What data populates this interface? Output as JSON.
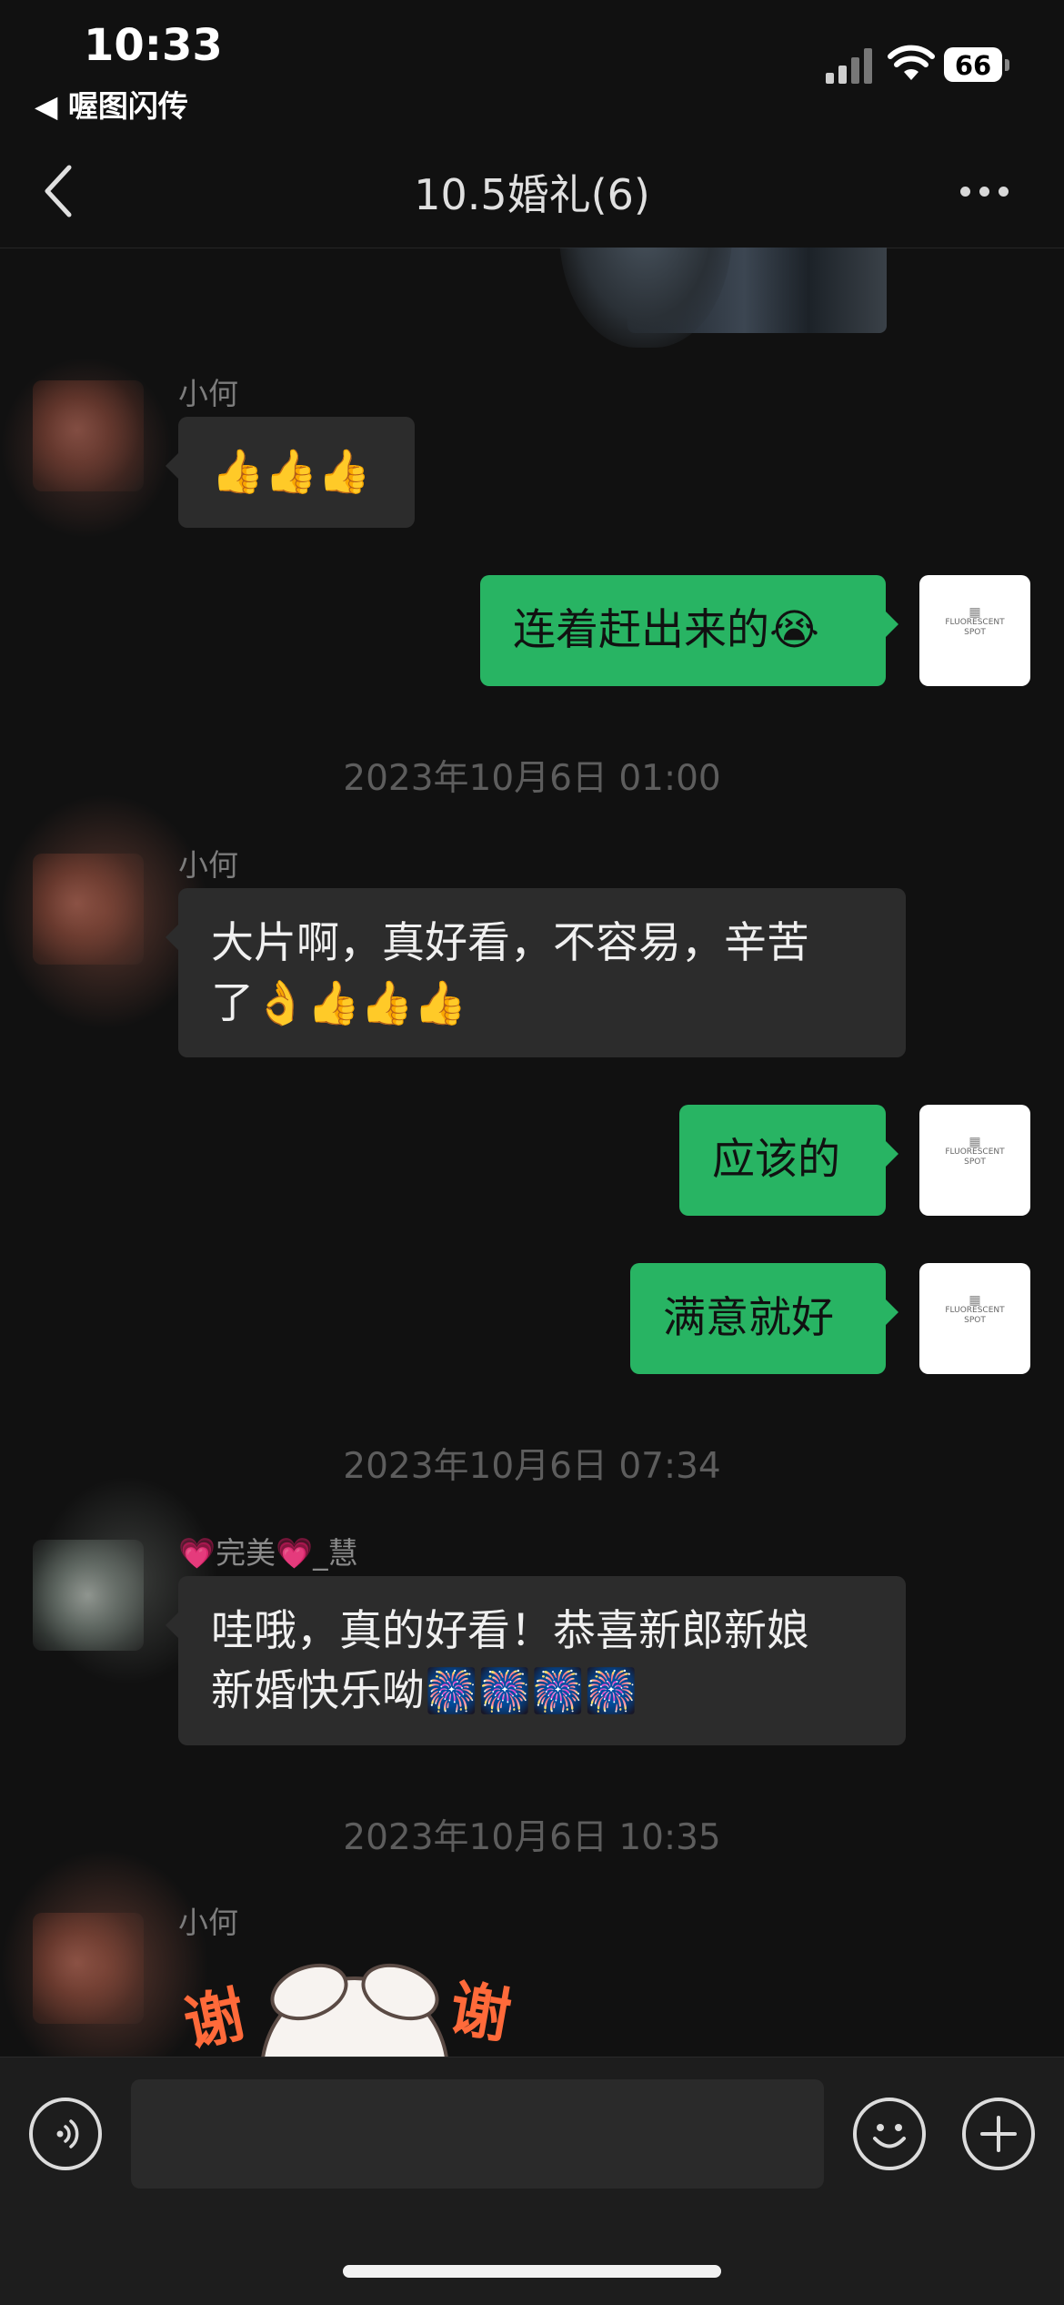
{
  "status_bar": {
    "time": "10:33",
    "back_app": "◀ 喔图闪传",
    "battery": "66"
  },
  "nav": {
    "title": "10.5婚礼(6)"
  },
  "messages": {
    "m1_name": "小何",
    "m1_text": "👍👍👍",
    "m2_text": "连着赶出来的😭",
    "stamp1": "2023年10月6日 01:00",
    "m3_name": "小何",
    "m3_line1": "大片啊，真好看，不容易，辛苦",
    "m3_line2": "了👌👍👍👍",
    "m4_text": "应该的",
    "m5_text": "满意就好",
    "stamp2": "2023年10月6日 07:34",
    "m6_name": "💗完美💗_慧",
    "m6_line1": "哇哦，真的好看！恭喜新郎新娘",
    "m6_line2": "新婚快乐呦🎆🎆🎆🎆",
    "stamp3": "2023年10月6日 10:35",
    "m7_name": "小何",
    "sticker_text_left": "谢",
    "sticker_text_right": "谢"
  },
  "my_avatar": {
    "logo_line1": "FLUORESCENT",
    "logo_line2": "SPOT"
  },
  "colors": {
    "background": "#111111",
    "incoming_bubble": "#2c2c2c",
    "outgoing_bubble": "#28b463"
  },
  "icons": {
    "voice": "voice-icon",
    "emoji": "emoji-icon",
    "plus": "plus-icon"
  }
}
